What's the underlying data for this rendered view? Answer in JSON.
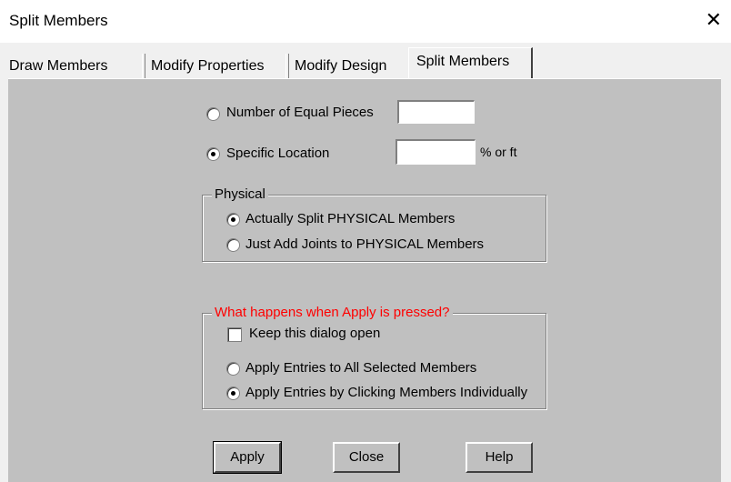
{
  "window": {
    "title": "Split Members",
    "close_glyph": "✕"
  },
  "tabs": [
    {
      "label": "Draw Members"
    },
    {
      "label": "Modify Properties"
    },
    {
      "label": "Modify Design"
    },
    {
      "label": "Split Members",
      "active": true
    }
  ],
  "split_options": {
    "equal_pieces": {
      "label": "Number of Equal Pieces",
      "selected": false,
      "value": ""
    },
    "specific_location": {
      "label": "Specific Location",
      "selected": true,
      "value": "",
      "unit": "% or ft"
    }
  },
  "physical": {
    "title": "Physical",
    "options": [
      {
        "label": "Actually Split PHYSICAL Members",
        "selected": true
      },
      {
        "label": "Just Add Joints to PHYSICAL Members",
        "selected": false
      }
    ]
  },
  "apply_behavior": {
    "title": "What happens when Apply is pressed?",
    "title_color": "#ff0000",
    "keep_open": {
      "label": "Keep this dialog open",
      "checked": false
    },
    "options": [
      {
        "label": "Apply Entries to All Selected Members",
        "selected": false
      },
      {
        "label": "Apply Entries by Clicking Members Individually",
        "selected": true
      }
    ]
  },
  "buttons": {
    "apply": "Apply",
    "close": "Close",
    "help": "Help"
  }
}
